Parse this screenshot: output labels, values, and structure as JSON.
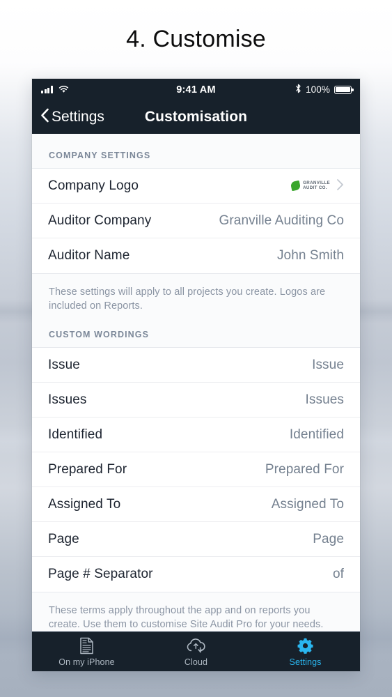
{
  "page": {
    "heading": "4. Customise"
  },
  "status_bar": {
    "signal_icon": "cellular-bars-icon",
    "wifi_icon": "wifi-icon",
    "time": "9:41 AM",
    "bluetooth_icon": "bluetooth-icon",
    "battery_percent": "100%",
    "battery_icon": "battery-full-icon"
  },
  "nav_bar": {
    "back_icon": "chevron-left-icon",
    "back_label": "Settings",
    "title": "Customisation"
  },
  "sections": [
    {
      "header": "COMPANY SETTINGS",
      "rows": [
        {
          "label": "Company Logo",
          "value": "",
          "logo": {
            "mark": "green-leaf-icon",
            "line1": "GRANVILLE",
            "line2": "AUDIT CO."
          },
          "disclosure": "›"
        },
        {
          "label": "Auditor Company",
          "value": "Granville Auditing Co"
        },
        {
          "label": "Auditor Name",
          "value": "John Smith"
        }
      ],
      "footnote": "These settings will apply to all projects you create. Logos are included on Reports."
    },
    {
      "header": "CUSTOM WORDINGS",
      "rows": [
        {
          "label": "Issue",
          "value": "Issue"
        },
        {
          "label": "Issues",
          "value": "Issues"
        },
        {
          "label": "Identified",
          "value": "Identified"
        },
        {
          "label": "Prepared For",
          "value": "Prepared For"
        },
        {
          "label": "Assigned To",
          "value": "Assigned To"
        },
        {
          "label": "Page",
          "value": "Page"
        },
        {
          "label": "Page # Separator",
          "value": "of"
        }
      ],
      "footnote": "These terms apply throughout the app and on reports you create. Use them to customise Site Audit Pro for your needs."
    }
  ],
  "tab_bar": {
    "tabs": [
      {
        "label": "On my iPhone",
        "icon": "document-icon",
        "active": false
      },
      {
        "label": "Cloud",
        "icon": "cloud-sync-icon",
        "active": false
      },
      {
        "label": "Settings",
        "icon": "gear-icon",
        "active": true
      }
    ],
    "active_color": "#2ab6ef"
  }
}
